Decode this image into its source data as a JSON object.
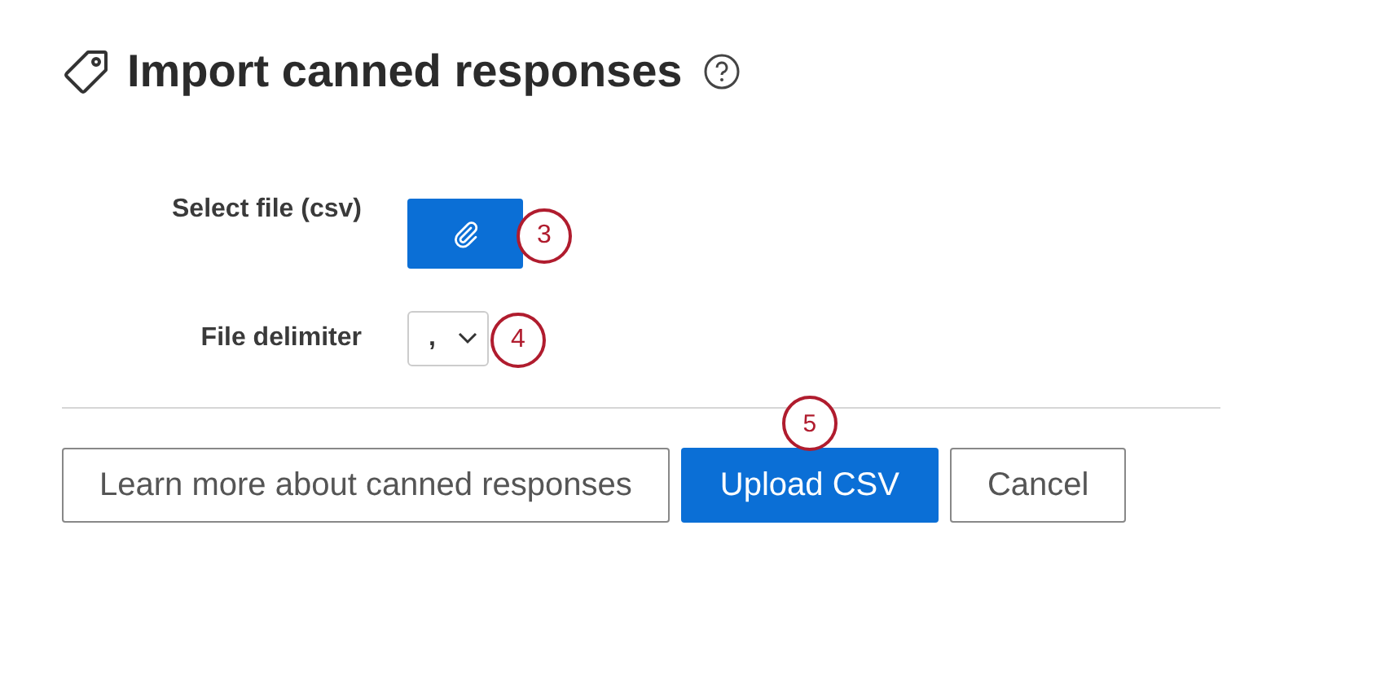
{
  "dialog": {
    "title": "Import canned responses"
  },
  "fields": [
    {
      "kind": "file",
      "label": "Select file (csv)",
      "callout": "3"
    },
    {
      "kind": "select",
      "label": "File delimiter",
      "value": ",",
      "callout": "4"
    }
  ],
  "buttons": [
    {
      "label": "Learn more about canned responses",
      "kind": "secondary"
    },
    {
      "label": "Upload CSV",
      "kind": "primary",
      "callout": "5"
    },
    {
      "label": "Cancel",
      "kind": "secondary"
    }
  ]
}
